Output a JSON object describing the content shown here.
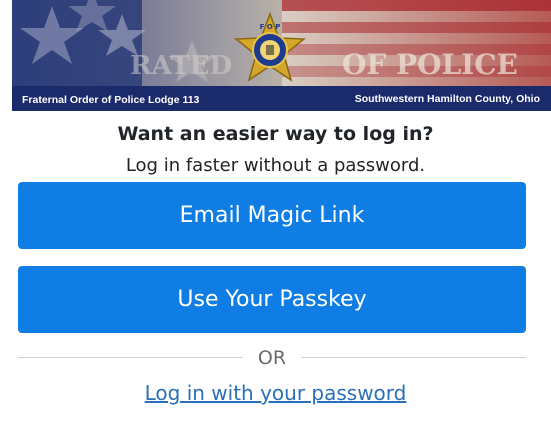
{
  "banner": {
    "left_caption": "Fraternal Order of Police Lodge 113",
    "right_caption": "Southwestern Hamilton County, Ohio",
    "emblem_letters": "F O P",
    "background_words": [
      "RATED",
      "OF POLICE"
    ],
    "colors": {
      "navy": "#1b2a6b",
      "flag_red": "#a8262c",
      "star_gold": "#d4a62a"
    }
  },
  "login": {
    "heading": "Want an easier way to log in?",
    "subheading": "Log in faster without a password.",
    "magic_link_label": "Email Magic Link",
    "passkey_label": "Use Your Passkey",
    "divider_label": "OR",
    "password_link_label": "Log in with your password"
  },
  "colors": {
    "button": "#0f7de3",
    "link": "#2a6fb7",
    "divider_line": "#cfcfcf"
  }
}
